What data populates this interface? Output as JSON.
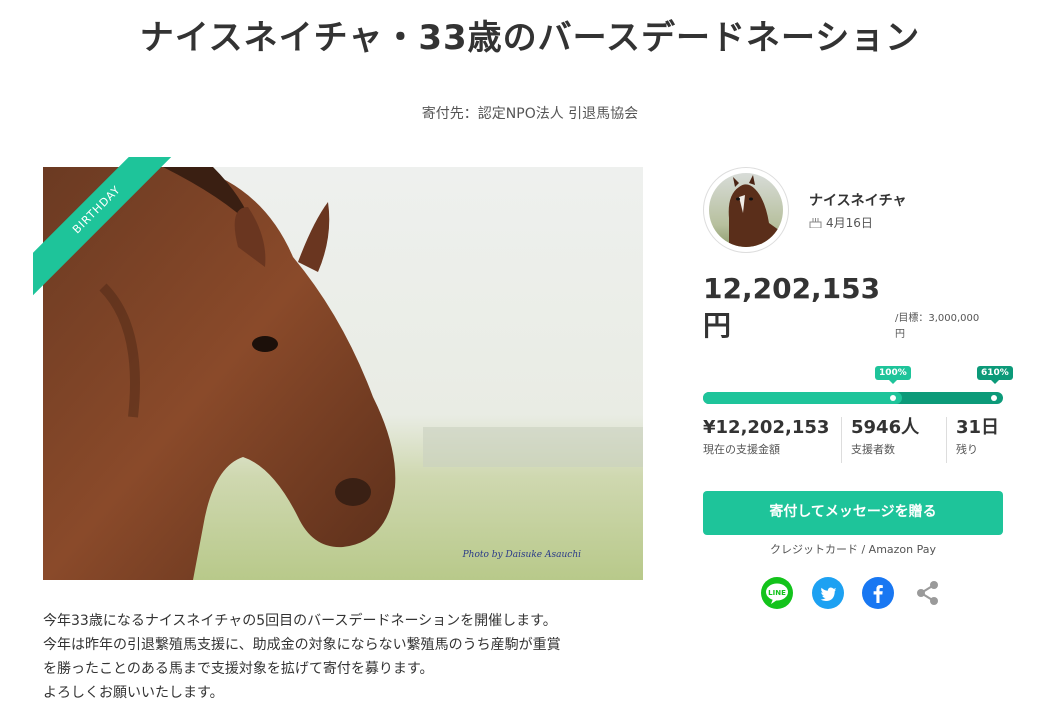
{
  "page": {
    "title": "ナイスネイチャ・33歳のバースデードネーション",
    "donate_to": "寄付先：認定NPO法人 引退馬協会"
  },
  "hero": {
    "ribbon": "BIRTHDAY",
    "photo_credit": "Photo by Daisuke Asauchi"
  },
  "description": {
    "lines": [
      "今年33歳になるナイスネイチャの5回目のバースデードネーションを開催します。",
      "今年は昨年の引退繋殖馬支援に、助成金の対象にならない繋殖馬のうち産駒が重賞",
      "を勝ったことのある馬まで支援対象を拡げて寄付を募ります。",
      "よろしくお願いいたします。"
    ]
  },
  "profile": {
    "name": "ナイスネイチャ",
    "birthday": "4月16日"
  },
  "funding": {
    "amount_number": "12,202,153",
    "amount_unit": "円",
    "goal_text": "/目標：3,000,000",
    "goal_unit": "円",
    "progress_badge_1": "100%",
    "progress_badge_2": "610%",
    "progress_percent": 610,
    "stats": {
      "raised_value": "¥12,202,153",
      "raised_label": "現在の支援金額",
      "supporters_value": "5946人",
      "supporters_label": "支援者数",
      "days_value": "31日",
      "days_label": "残り"
    }
  },
  "cta": {
    "label": "寄付してメッセージを贈る",
    "payment_methods": "クレジットカード / Amazon Pay"
  },
  "share": {
    "line_label": "LINE",
    "icons": [
      "line-icon",
      "twitter-icon",
      "facebook-icon",
      "share-icon"
    ]
  },
  "colors": {
    "accent": "#1ec49a",
    "accent_dark": "#0c9a79"
  }
}
